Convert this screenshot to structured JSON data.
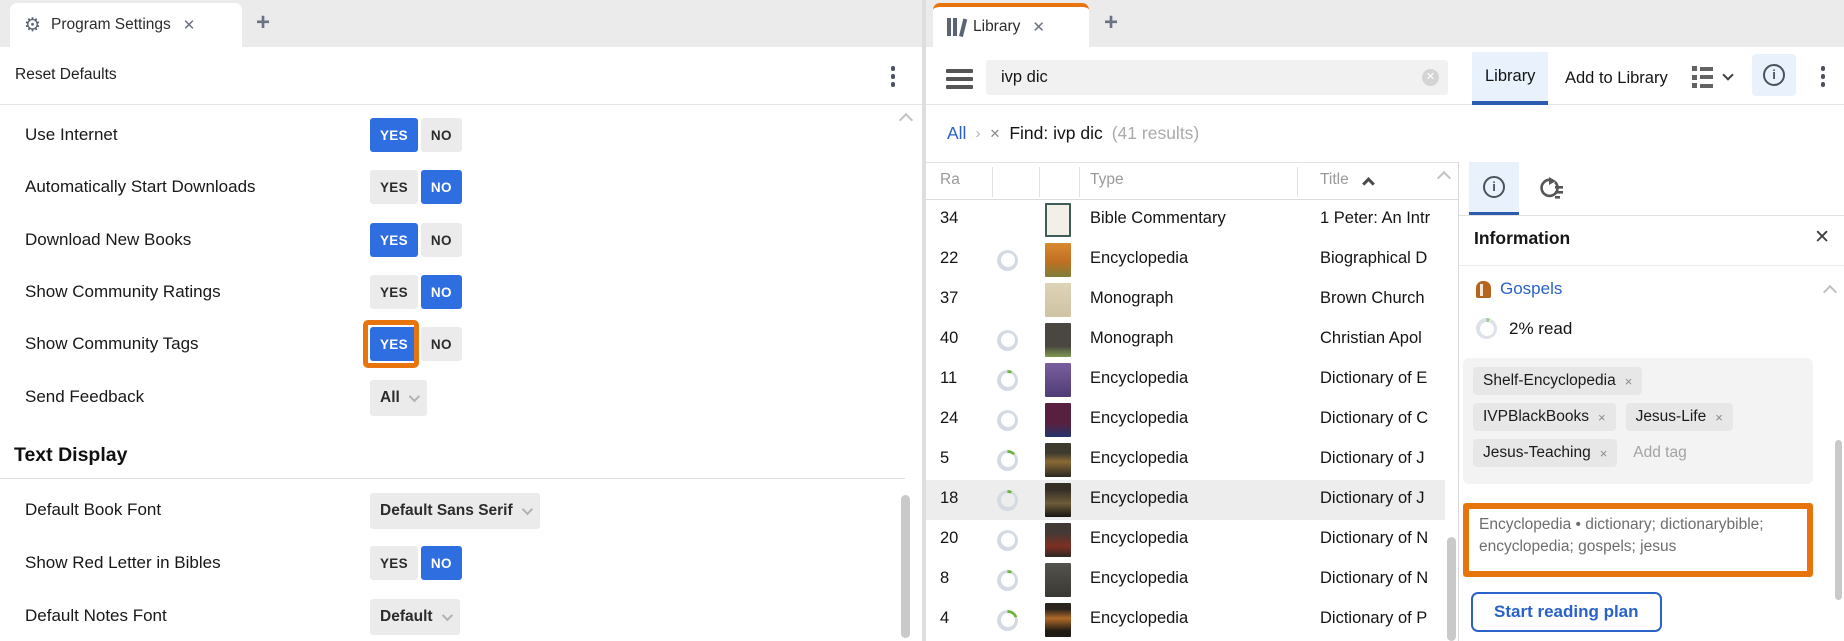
{
  "colors": {
    "accent_blue": "#2e6ee0",
    "link_blue": "#2a62c9",
    "selected_tab_underline": "#2b5caf",
    "highlight_orange": "#e8740e",
    "progress_green": "#6cb33f",
    "tab_active_top": "#e8740e"
  },
  "icons": {
    "left_tab": "gear-icon",
    "right_tab": "library-books-icon",
    "toolbar_left": "hamburger-menu-icon",
    "search_clear": "clear-circle-icon",
    "views": "grid-view-icon",
    "info": "info-circle-icon",
    "overflow": "kebab-menu-icon",
    "resource": "book-icon",
    "plan_tab": "reading-plan-icon"
  },
  "left_panel": {
    "tab_title": "Program Settings",
    "close_tab": "✕",
    "new_tab": "+",
    "reset_defaults": "Reset Defaults",
    "yes": "YES",
    "no": "NO",
    "settings": [
      {
        "label": "Use Internet",
        "value": "YES"
      },
      {
        "label": "Automatically Start Downloads",
        "value": "NO"
      },
      {
        "label": "Download New Books",
        "value": "YES"
      },
      {
        "label": "Show Community Ratings",
        "value": "NO"
      },
      {
        "label": "Show Community Tags",
        "value": "YES"
      },
      {
        "label": "Send Feedback",
        "value": "All"
      }
    ],
    "section_title": "Text Display",
    "text_display": [
      {
        "label": "Default Book Font",
        "value": "Default Sans Serif"
      },
      {
        "label": "Show Red Letter in Bibles",
        "value": "NO"
      },
      {
        "label": "Default Notes Font",
        "value": "Default"
      }
    ]
  },
  "right_panel": {
    "tab_title": "Library",
    "close_tab": "✕",
    "new_tab": "+",
    "search_value": "ivp dic",
    "view_tabs": {
      "library": "Library",
      "add": "Add to Library"
    },
    "breadcrumb": {
      "root": "All",
      "sep": "›",
      "remove": "✕",
      "find": "Find: ivp dic",
      "results": "(41 results)"
    },
    "table": {
      "headers": {
        "rating": "Ra",
        "type": "Type",
        "title": "Title"
      },
      "rows": [
        {
          "rank": "34",
          "type": "Bible Commentary",
          "title": "1 Peter: An Intr"
        },
        {
          "rank": "22",
          "type": "Encyclopedia",
          "title": "Biographical D"
        },
        {
          "rank": "37",
          "type": "Monograph",
          "title": "Brown Church"
        },
        {
          "rank": "40",
          "type": "Monograph",
          "title": "Christian Apol"
        },
        {
          "rank": "11",
          "type": "Encyclopedia",
          "title": "Dictionary of E"
        },
        {
          "rank": "24",
          "type": "Encyclopedia",
          "title": "Dictionary of C"
        },
        {
          "rank": "5",
          "type": "Encyclopedia",
          "title": "Dictionary of J"
        },
        {
          "rank": "18",
          "type": "Encyclopedia",
          "title": "Dictionary of J"
        },
        {
          "rank": "20",
          "type": "Encyclopedia",
          "title": "Dictionary of N"
        },
        {
          "rank": "8",
          "type": "Encyclopedia",
          "title": "Dictionary of N"
        },
        {
          "rank": "4",
          "type": "Encyclopedia",
          "title": "Dictionary of P"
        }
      ]
    },
    "info": {
      "title": "Information",
      "close": "✕",
      "resource_name": "Gospels",
      "percent_read": "2% read",
      "tags": [
        "Shelf-Encyclopedia",
        "IVPBlackBooks",
        "Jesus-Life",
        "Jesus-Teaching"
      ],
      "remove_tag": "×",
      "add_tag_placeholder": "Add tag",
      "community_tags": "Encyclopedia • dictionary; dictionarybible; encyclopedia; gospels; jesus",
      "start_reading_plan": "Start reading plan"
    }
  }
}
